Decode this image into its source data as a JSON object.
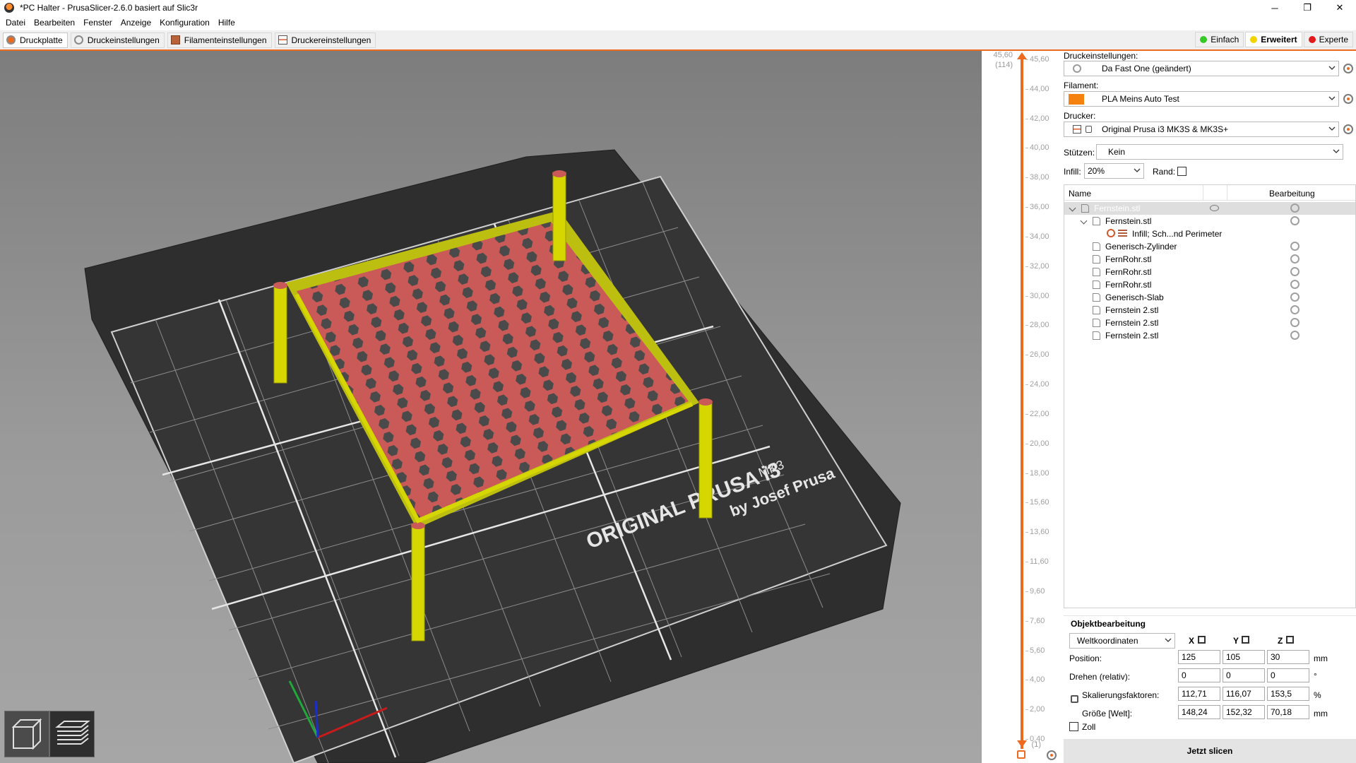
{
  "window": {
    "title": "*PC Halter - PrusaSlicer-2.6.0 basiert auf Slic3r",
    "minimize": "─",
    "maximize": "❐",
    "close": "✕"
  },
  "menu": [
    "Datei",
    "Bearbeiten",
    "Fenster",
    "Anzeige",
    "Konfiguration",
    "Hilfe"
  ],
  "tabs": [
    {
      "label": "Druckplatte",
      "active": true
    },
    {
      "label": "Druckeinstellungen",
      "active": false
    },
    {
      "label": "Filamenteinstellungen",
      "active": false
    },
    {
      "label": "Druckereinstellungen",
      "active": false
    }
  ],
  "modes": [
    {
      "label": "Einfach",
      "color": "#34c924",
      "active": false
    },
    {
      "label": "Erweitert",
      "color": "#f5d300",
      "active": true
    },
    {
      "label": "Experte",
      "color": "#e41a1a",
      "active": false
    }
  ],
  "bed": {
    "brand_line1": "ORIGINAL PRUSA i3",
    "brand_mk": "MK3",
    "brand_line2": "by Josef Prusa"
  },
  "layer_slider": {
    "top_value": "45,60",
    "top_layer": "(114)",
    "bottom_value": "0,40",
    "bottom_layer": "(1)",
    "ticks": [
      "45,60",
      "44,00",
      "42,00",
      "40,00",
      "38,00",
      "36,00",
      "34,00",
      "32,00",
      "30,00",
      "28,00",
      "26,00",
      "24,00",
      "22,00",
      "20,00",
      "18,00",
      "15,60",
      "13,60",
      "11,60",
      "9,60",
      "7,60",
      "5,60",
      "4,00",
      "2,00",
      "0,40"
    ]
  },
  "sidebar": {
    "print_settings_label": "Druckeinstellungen:",
    "print_settings_value": "Da Fast One (geändert)",
    "filament_label": "Filament:",
    "filament_value": "PLA Meins Auto Test",
    "filament_color": "#f5820f",
    "printer_label": "Drucker:",
    "printer_value": "Original Prusa i3 MK3S & MK3S+",
    "supports_label": "Stützen:",
    "supports_value": "Kein",
    "infill_label": "Infill:",
    "infill_value": "20%",
    "brim_label": "Rand:"
  },
  "object_list": {
    "col_name": "Name",
    "col_edit": "Bearbeitung",
    "rows": [
      {
        "label": "Fernstein.stl",
        "indent": 0,
        "selected": true,
        "expander": "v",
        "eye": true
      },
      {
        "label": "Fernstein.stl",
        "indent": 1,
        "expander": "v"
      },
      {
        "label": "Infill; Sch...nd Perimeter",
        "indent": 2,
        "settings": true
      },
      {
        "label": "Generisch-Zylinder",
        "indent": 1
      },
      {
        "label": "FernRohr.stl",
        "indent": 1
      },
      {
        "label": "FernRohr.stl",
        "indent": 1
      },
      {
        "label": "FernRohr.stl",
        "indent": 1
      },
      {
        "label": "Generisch-Slab",
        "indent": 1
      },
      {
        "label": "Fernstein 2.stl",
        "indent": 1
      },
      {
        "label": "Fernstein 2.stl",
        "indent": 1
      },
      {
        "label": "Fernstein 2.stl",
        "indent": 1
      }
    ]
  },
  "object_manipulation": {
    "title": "Objektbearbeitung",
    "coord_system": "Weltkoordinaten",
    "axis_x": "X",
    "axis_y": "Y",
    "axis_z": "Z",
    "position_label": "Position:",
    "position": [
      "125",
      "105",
      "30"
    ],
    "position_unit": "mm",
    "rotation_label": "Drehen (relativ):",
    "rotation": [
      "0",
      "0",
      "0"
    ],
    "rotation_unit": "°",
    "scale_label": "Skalierungsfaktoren:",
    "scale": [
      "112,71",
      "116,07",
      "153,5"
    ],
    "scale_unit": "%",
    "size_label": "Größe [Welt]:",
    "size": [
      "148,24",
      "152,32",
      "70,18"
    ],
    "size_unit": "mm",
    "inch_label": "Zoll"
  },
  "slice_button": "Jetzt slicen"
}
